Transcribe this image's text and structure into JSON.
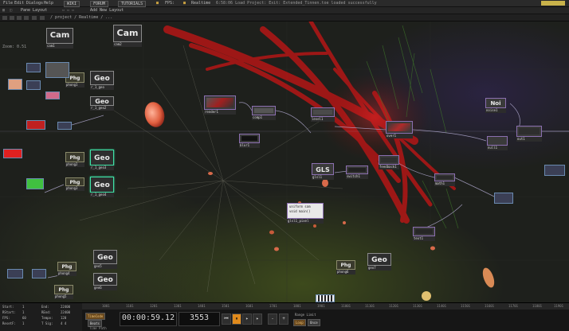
{
  "menubar": {
    "menus": [
      "File",
      "Edit",
      "Dialogs",
      "Help"
    ],
    "tags": [
      "WIKI",
      "FORUM",
      "TUTORIALS"
    ],
    "fps_label": "FPS:",
    "realtime_label": "Realtime",
    "status": "6:58:06 Load Project: Exit: Extended_Tinnen.toe loaded successfully",
    "badge_color": "#c9b24a"
  },
  "layoutbar": {
    "pane_layout_label": "Pane Layout",
    "add_layout_label": "Add New Layout"
  },
  "pathbar": {
    "path": "/ project / Realtime / ..."
  },
  "network": {
    "zoom": "Zoom: 0.51",
    "nodes": {
      "cam1": {
        "title": "Cam",
        "label": "cam1"
      },
      "cam2": {
        "title": "Cam",
        "label": "cam2"
      },
      "geo1": {
        "title": "Geo",
        "label": "r_1_geo"
      },
      "geo2": {
        "title": "Geo",
        "label": "r_1_geo2"
      },
      "geo3": {
        "title": "Geo",
        "label": "r_1_geo3"
      },
      "geo4": {
        "title": "Geo",
        "label": "r_1_geo4"
      },
      "geo5": {
        "title": "Geo",
        "label": "geo5"
      },
      "geo6": {
        "title": "Geo",
        "label": "geo6"
      },
      "geo7": {
        "title": "Geo",
        "label": "geo7"
      },
      "phg1": {
        "title": "Phg",
        "label": "phong1"
      },
      "phg2": {
        "title": "Phg",
        "label": "phong2"
      },
      "phg3": {
        "title": "Phg",
        "label": "phong3"
      },
      "phg4": {
        "title": "Phg",
        "label": "phong4"
      },
      "phg5": {
        "title": "Phg",
        "label": "phong5"
      },
      "phg6": {
        "title": "Phg",
        "label": "phong6"
      },
      "gls": {
        "title": "GLS",
        "label": "glsl1"
      },
      "noi": {
        "title": "Noi",
        "label": "noise1"
      },
      "render1": {
        "label": "render1"
      },
      "comp1": {
        "label": "comp1"
      },
      "level1": {
        "label": "level1"
      },
      "blur1": {
        "label": "blur1"
      },
      "over1": {
        "label": "over1"
      },
      "out1": {
        "label": "out1"
      },
      "switch1": {
        "label": "switch1"
      },
      "feedback1": {
        "label": "feedback1"
      },
      "math1": {
        "label": "math1"
      },
      "null1": {
        "label": "null1"
      },
      "text1": {
        "label": "text1"
      },
      "glsl_dat": {
        "line1": "uniform sam",
        "line2": "void main()",
        "label": "glsl1_pixel"
      }
    }
  },
  "timeline": {
    "ruler_ticks": [
      "1001",
      "1101",
      "1201",
      "1301",
      "1401",
      "1501",
      "1601",
      "1701",
      "1801",
      "1901",
      "11001",
      "11101",
      "11201",
      "11301",
      "11401",
      "11501",
      "11601",
      "11701",
      "11801",
      "11901"
    ],
    "info": {
      "start_label": "Start:",
      "start_val": "1",
      "end_label": "End:",
      "end_val": "22400",
      "rstart_label": "RStart:",
      "rstart_val": "1",
      "rend_label": "REnd:",
      "rend_val": "22400",
      "fps_label": "FPS:",
      "fps_val": "60",
      "tempo_label": "Tempo:",
      "tempo_val": "120",
      "resetf_label": "ResetF:",
      "resetf_val": "1",
      "tsig_label": "T Sig:",
      "tsig_val": "4    4"
    },
    "timecode_label": "TimeCode",
    "beats_label": "Beats",
    "time_paths_label": "Time Path",
    "timecode": "00:00:59.12",
    "frame": "3553",
    "range_limit_label": "Range Limit",
    "loop_label": "Loop",
    "once_label": "Once"
  }
}
